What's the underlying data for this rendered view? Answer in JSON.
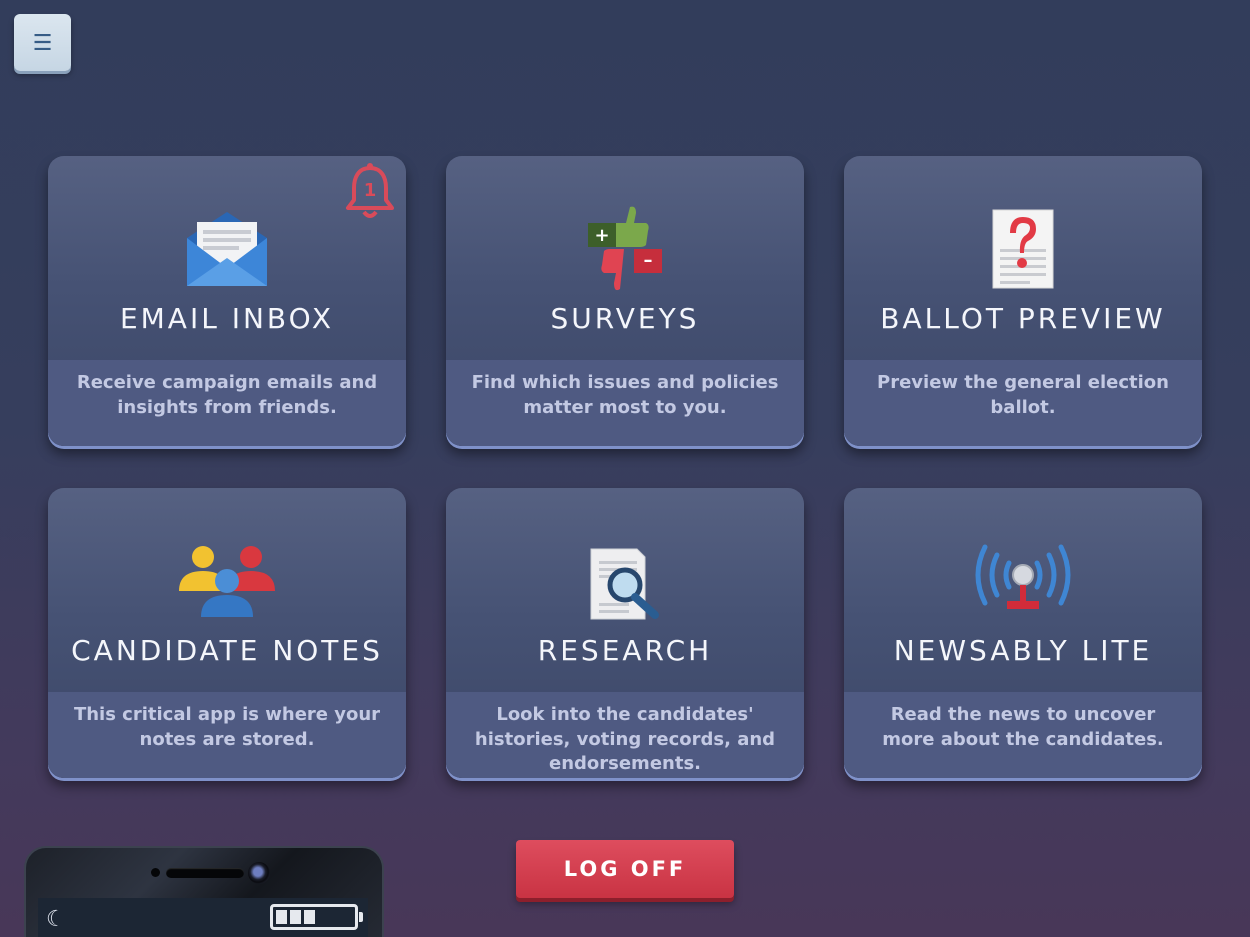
{
  "menu": {
    "icon": "hamburger-menu-icon"
  },
  "cards": [
    {
      "title": "EMAIL INBOX",
      "desc": "Receive campaign emails and insights from friends.",
      "icon": "envelope-icon",
      "badge": "1"
    },
    {
      "title": "SURVEYS",
      "desc": "Find which issues and policies matter most to you.",
      "icon": "thumbs-up-down-icon"
    },
    {
      "title": "BALLOT PREVIEW",
      "desc": "Preview the general election ballot.",
      "icon": "ballot-question-icon"
    },
    {
      "title": "CANDIDATE NOTES",
      "desc": "This critical app is where your notes are stored.",
      "icon": "people-icon"
    },
    {
      "title": "RESEARCH",
      "desc": "Look into the candidates' histories, voting records, and endorsements.",
      "icon": "document-magnifier-icon"
    },
    {
      "title": "NEWSABLY LITE",
      "desc": "Read the news to uncover more about the candidates.",
      "icon": "broadcast-antenna-icon"
    }
  ],
  "logoff": {
    "label": "LOG OFF"
  },
  "colors": {
    "accent": "#d9404f",
    "card": "#4f5a82"
  }
}
